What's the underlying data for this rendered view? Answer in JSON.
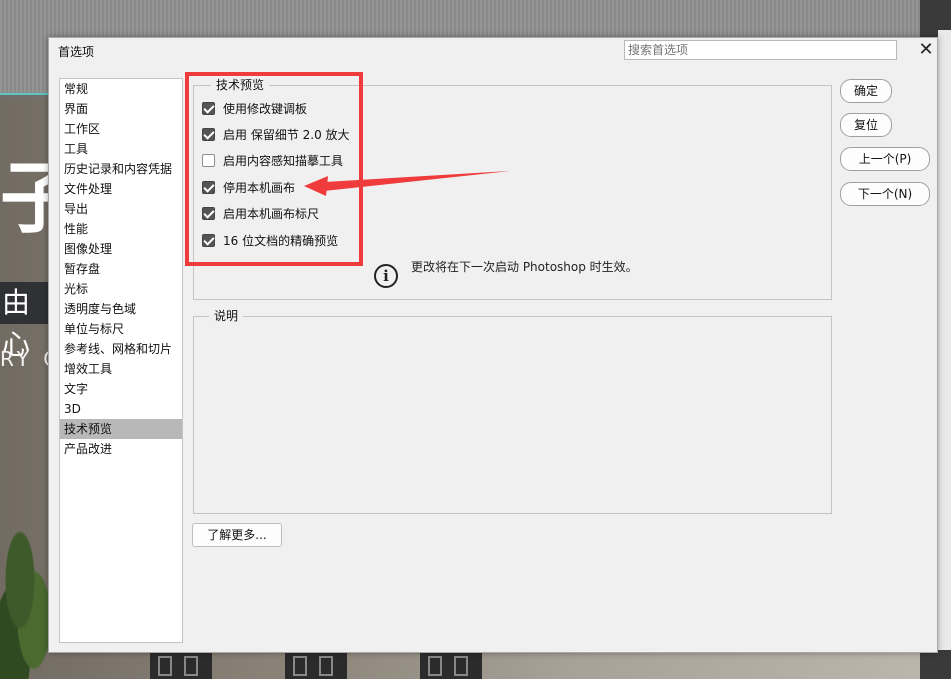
{
  "dialog": {
    "title": "首选项",
    "search_placeholder": "搜索首选项",
    "close_glyph": "✕"
  },
  "sidebar": {
    "items": [
      {
        "label": "常规"
      },
      {
        "label": "界面"
      },
      {
        "label": "工作区"
      },
      {
        "label": "工具"
      },
      {
        "label": "历史记录和内容凭据"
      },
      {
        "label": "文件处理"
      },
      {
        "label": "导出"
      },
      {
        "label": "性能"
      },
      {
        "label": "图像处理"
      },
      {
        "label": "暂存盘"
      },
      {
        "label": "光标"
      },
      {
        "label": "透明度与色域"
      },
      {
        "label": "单位与标尺"
      },
      {
        "label": "参考线、网格和切片"
      },
      {
        "label": "增效工具"
      },
      {
        "label": "文字"
      },
      {
        "label": "3D"
      },
      {
        "label": "技术预览"
      },
      {
        "label": "产品改进"
      }
    ],
    "selected": "技术预览"
  },
  "tech_preview": {
    "group_title": "技术预览",
    "options": [
      {
        "label": "使用修改键调板",
        "checked": true
      },
      {
        "label": "启用 保留细节 2.0 放大",
        "checked": true
      },
      {
        "label": "启用内容感知描摹工具",
        "checked": false
      },
      {
        "label": "停用本机画布",
        "checked": true
      },
      {
        "label": "启用本机画布标尺",
        "checked": true
      },
      {
        "label": "16 位文档的精确预览",
        "checked": true
      }
    ],
    "info_glyph": "i",
    "info_text": "更改将在下一次启动 Photoshop 时生效。"
  },
  "description": {
    "group_title": "说明"
  },
  "buttons": {
    "ok": "确定",
    "reset": "复位",
    "prev": "上一个(P)",
    "next": "下一个(N)",
    "learn_more": "了解更多..."
  },
  "background": {
    "big_char": "子",
    "dark_label": "由心",
    "english": "RY G"
  },
  "colors": {
    "annotation": "#ef3b3b",
    "dialog_bg": "#f0f0f0",
    "selected_item": "#b8b8b8"
  }
}
